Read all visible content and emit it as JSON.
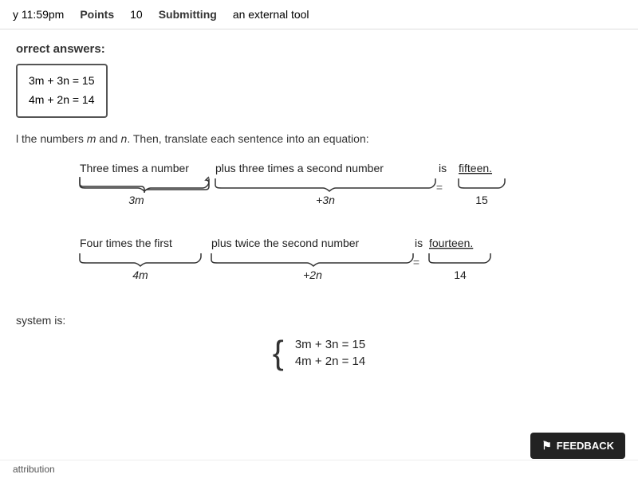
{
  "header": {
    "due_time": "y 11:59pm",
    "points_label": "Points",
    "points_value": "10",
    "submitting_label": "Submitting",
    "submitting_value": "an external tool"
  },
  "correct_answers": {
    "label": "orrect answers:",
    "eq1": "3m + 3n = 15",
    "eq2": "4m + 2n = 14"
  },
  "instruction": {
    "text_before": "l the numbers ",
    "var1": "m",
    "text_middle": " and ",
    "var2": "n",
    "text_after": ". Then, translate each sentence into an equation:"
  },
  "diagram1": {
    "sentence": "Three times a number plus three times a second number  is  fifteen.",
    "part1_text": "Three times a number",
    "part2_text": "plus three times a second number",
    "equals_text": "is",
    "part3_text": "fifteen.",
    "label1": "3m",
    "equals_sym": "=",
    "label2": "+3n",
    "result": "15"
  },
  "diagram2": {
    "sentence": "Four times the first  plus twice the second number  is  fourteen.",
    "part1_text": "Four times the first",
    "part2_text": "plus twice the second number",
    "equals_text": "is",
    "part3_text": "fourteen.",
    "label1": "4m",
    "equals_sym": "=",
    "label2": "+2n",
    "result": "14"
  },
  "system": {
    "label": "system is:",
    "eq1": "3m + 3n = 15",
    "eq2": "4m + 2n = 14"
  },
  "feedback": {
    "label": "FEEDBACK",
    "icon": "⚑"
  },
  "attribution": {
    "text": "attribution"
  }
}
